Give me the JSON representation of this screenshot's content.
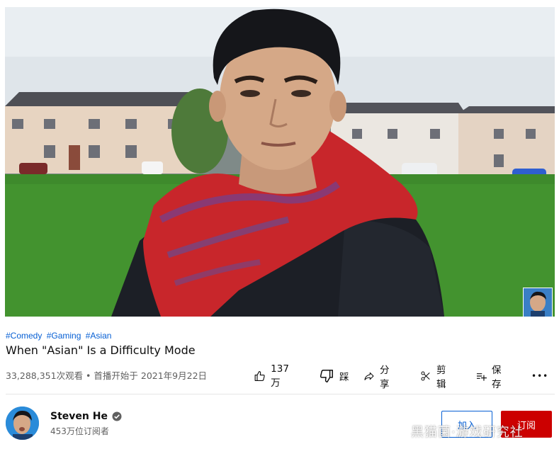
{
  "video": {
    "hashtags": [
      "#Comedy",
      "#Gaming",
      "#Asian"
    ],
    "title": "When \"Asian\" Is a Difficulty Mode",
    "meta": "33,288,351次观看 • 首播开始于 2021年9月22日"
  },
  "actions": {
    "like_label": "137万",
    "dislike_label": "踩",
    "share_label": "分享",
    "clip_label": "剪辑",
    "save_label": "保存",
    "more_label": "•••"
  },
  "channel": {
    "name": "Steven He",
    "subscribers": "453万位订阅者",
    "join_label": "加入",
    "subscribe_label": "订阅"
  },
  "watermark": "黑猫菌·游戏研究社",
  "colors": {
    "link": "#065fd4",
    "subscribe_bg": "#cc0000",
    "secondary_text": "#606060",
    "scarf": "#c8262b"
  }
}
